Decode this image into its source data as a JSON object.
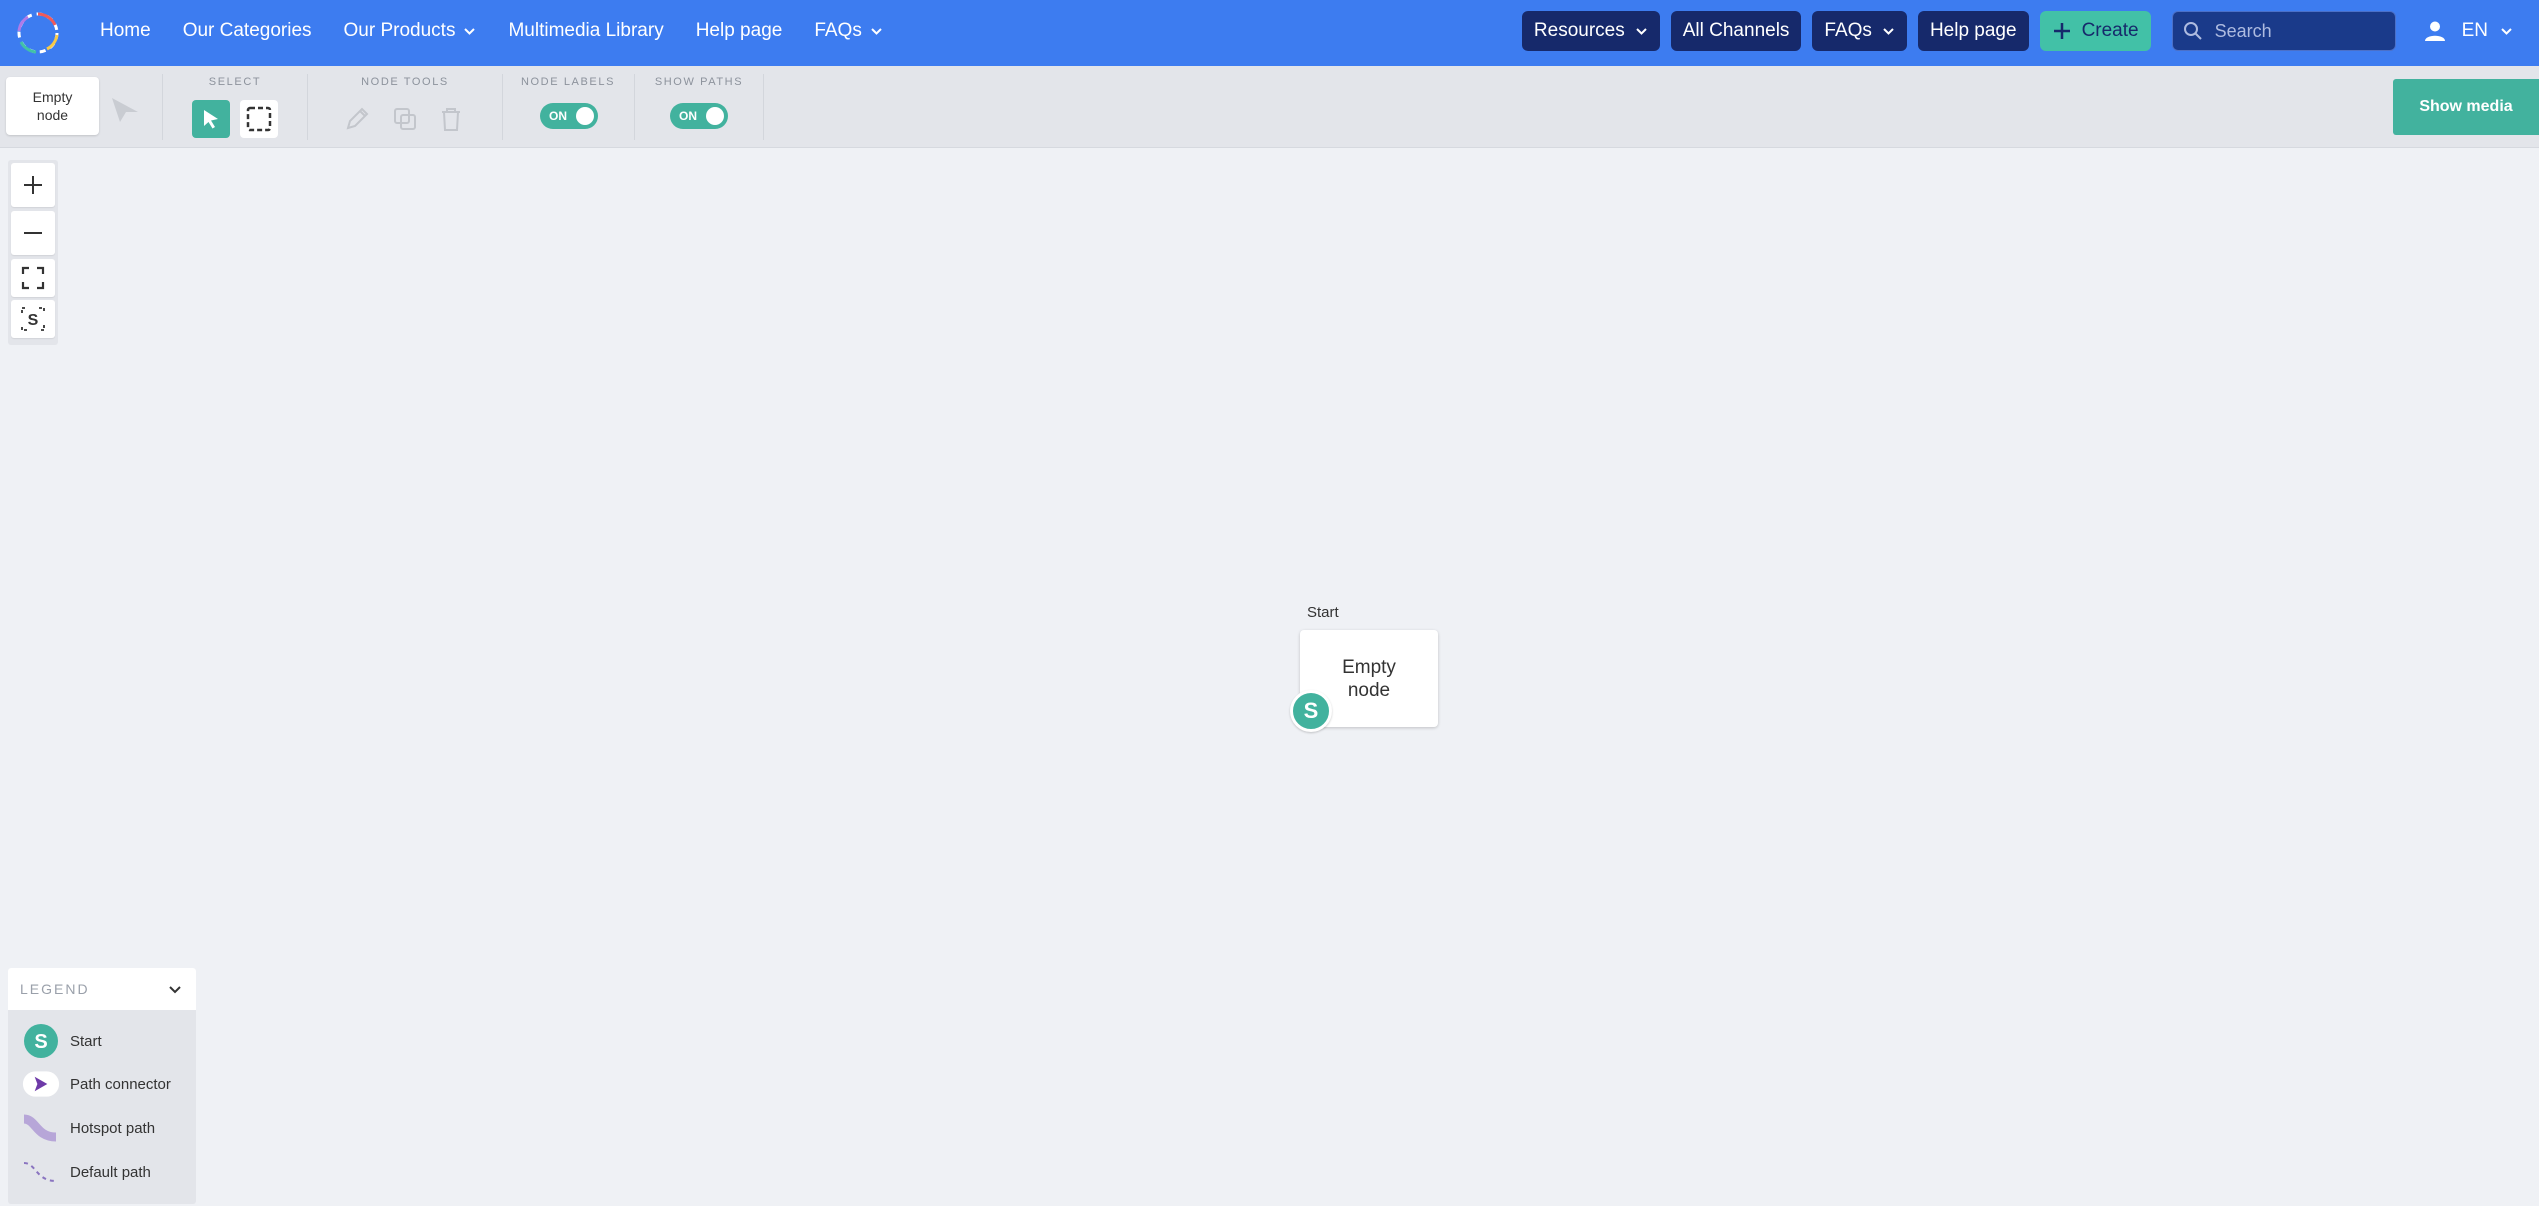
{
  "nav": {
    "links": [
      "Home",
      "Our Categories",
      "Our Products",
      "Multimedia Library",
      "Help page",
      "FAQs"
    ],
    "right": {
      "resources": "Resources",
      "all_channels": "All Channels",
      "faqs": "FAQs",
      "help_page": "Help page",
      "create": "Create",
      "search_placeholder": "Search",
      "language": "EN"
    }
  },
  "toolbar": {
    "node_chip": "Empty node",
    "select_label": "SELECT",
    "node_tools_label": "NODE TOOLS",
    "node_labels_label": "NODE LABELS",
    "show_paths_label": "SHOW PATHS",
    "node_labels_toggle": "ON",
    "show_paths_toggle": "ON",
    "show_media": "Show media"
  },
  "canvas": {
    "node": {
      "label": "Start",
      "text": "Empty node",
      "badge": "S"
    }
  },
  "legend": {
    "title": "LEGEND",
    "items": [
      {
        "label": "Start",
        "icon": "start-icon"
      },
      {
        "label": "Path connector",
        "icon": "path-connector-icon"
      },
      {
        "label": "Hotspot path",
        "icon": "hotspot-path-icon"
      },
      {
        "label": "Default path",
        "icon": "default-path-icon"
      }
    ]
  },
  "colors": {
    "nav_bg": "#3d7cf0",
    "pill_bg": "#16296b",
    "create_bg": "#42c1a7",
    "accent_teal": "#42b29e",
    "canvas_bg": "#eff1f5"
  }
}
